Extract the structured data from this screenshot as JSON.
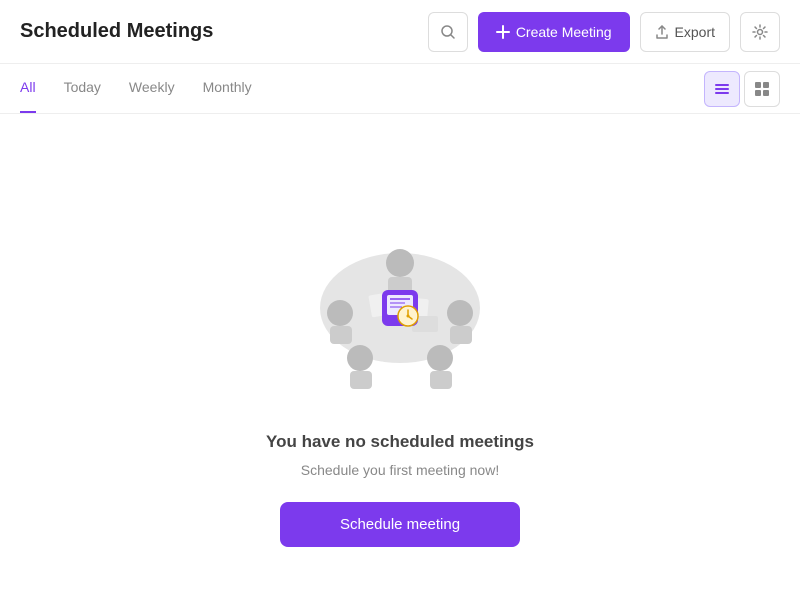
{
  "header": {
    "title": "Scheduled Meetings",
    "search_label": "Search",
    "create_label": "Create Meeting",
    "export_label": "Export",
    "settings_label": "Settings"
  },
  "tabs": {
    "items": [
      {
        "label": "All",
        "active": true
      },
      {
        "label": "Today",
        "active": false
      },
      {
        "label": "Weekly",
        "active": false
      },
      {
        "label": "Monthly",
        "active": false
      }
    ],
    "view_list": "List view",
    "view_grid": "Grid view"
  },
  "empty_state": {
    "title": "You have no scheduled meetings",
    "subtitle": "Schedule you first meeting now!",
    "button_label": "Schedule meeting"
  },
  "colors": {
    "purple": "#7c3aed",
    "purple_light": "#ede9fe"
  }
}
